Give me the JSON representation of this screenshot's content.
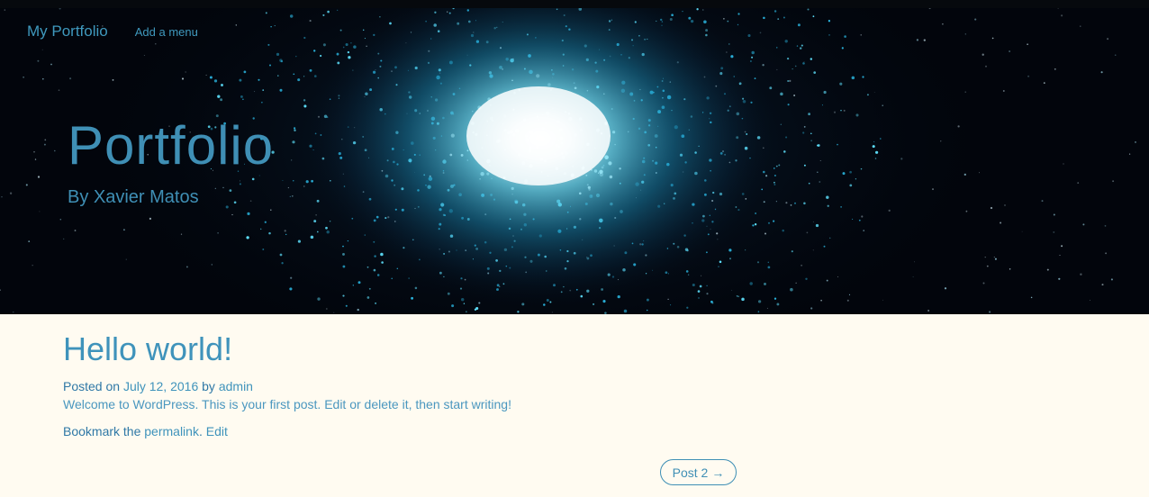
{
  "nav": {
    "brand": "My Portfolio",
    "menu_link": "Add a menu"
  },
  "hero": {
    "title": "Portfolio",
    "tagline": "By Xavier Matos",
    "background": "starburst-image"
  },
  "post": {
    "title": "Hello world!",
    "posted_on_label": "Posted on",
    "date": "July 12, 2016",
    "by_label": "by",
    "author": "admin",
    "body": "Welcome to WordPress. This is your first post. Edit or delete it, then start writing!",
    "bookmark_label": "Bookmark the",
    "permalink_label": "permalink",
    "edit_label": "Edit"
  },
  "pagination": {
    "next_label": "Post 2",
    "next_icon": "arrow-right-icon",
    "next_arrow": "→"
  },
  "colors": {
    "accent": "#3f93bb",
    "page_background": "#fffbf1",
    "hero_background": "#02050c"
  }
}
